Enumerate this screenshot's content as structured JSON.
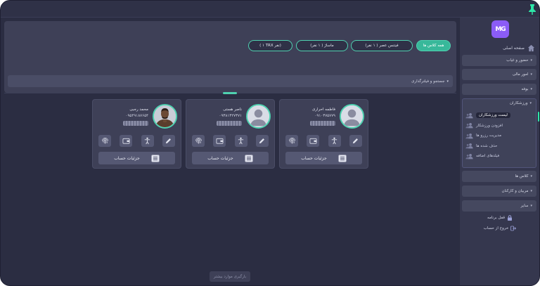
{
  "sidebar": {
    "logo_text": "MG",
    "home_label": "صفحه اصلی",
    "menu": [
      {
        "label": "حضور و غیاب"
      },
      {
        "label": "امور مالی"
      },
      {
        "label": "بوفه"
      },
      {
        "label": "ورزشکاران"
      },
      {
        "label": "کلاس ها"
      },
      {
        "label": "مربیان و کارکنان"
      },
      {
        "label": "سایر"
      }
    ],
    "athletes_sub": [
      {
        "label": "لیست ورزشکاران"
      },
      {
        "label": "افزودن ورزشکار"
      },
      {
        "label": "مدیریت رزرو ها"
      },
      {
        "label": "حذف شده ها"
      },
      {
        "label": "فیلدهای اضافه"
      }
    ],
    "lock_label": "قفل برنامه",
    "logout_label": "خروج از حساب"
  },
  "filters": {
    "chips": [
      {
        "label": "همه کلاس ها"
      },
      {
        "label": "فیتنس عصر ( ۱ نفر)"
      },
      {
        "label": "ماساژ ( ۱ نفر)"
      },
      {
        "label": "( ۱ TRX نفر)"
      }
    ],
    "search_label": "جستجو و فیلترگذاری"
  },
  "athletes": [
    {
      "name": "فاطمه احراری",
      "phone": "۰۹۱۰۳۷۵۷۷۹"
    },
    {
      "name": "ناصر هستی",
      "phone": "۰۹۳۸۱۳۲۷۳۷۱"
    },
    {
      "name": "محمد رجبی",
      "phone": "۰۹۵۴۹۱۸۷۶۵۴"
    }
  ],
  "details_label": "جزئیات حساب",
  "load_more_label": "بارگیری موارد بیشتر",
  "colors": {
    "accent": "#4fd1b0",
    "brand": "#8b5cf6",
    "background": "#2b2d42"
  }
}
